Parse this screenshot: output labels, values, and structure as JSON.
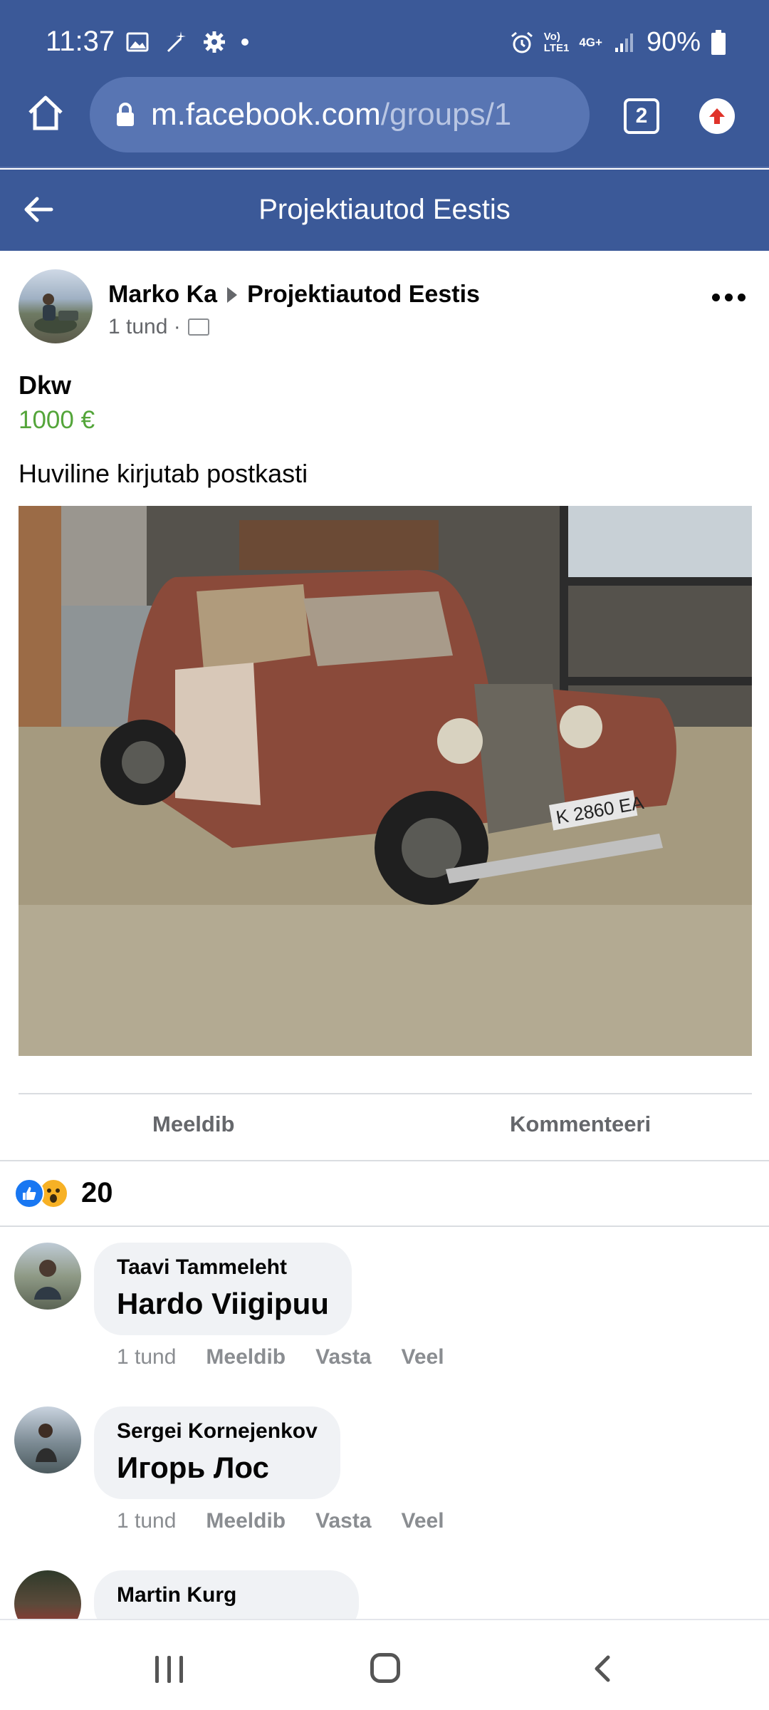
{
  "status_bar": {
    "time": "11:37",
    "battery": "90%",
    "network_top": "Vo)",
    "network_bottom": "LTE1",
    "net_type": "4G+"
  },
  "browser": {
    "url_host": "m.facebook.com",
    "url_path": "/groups/1",
    "tab_count": "2"
  },
  "header": {
    "title": "Projektiautod Eestis"
  },
  "post": {
    "author": "Marko Ka",
    "group": "Projektiautod Eestis",
    "time": "1 tund ·",
    "listing_title": "Dkw",
    "price": "1000 €",
    "text": "Huviline kirjutab postkasti",
    "image_plate_text": "K 2860 EA",
    "actions": {
      "like": "Meeldib",
      "comment": "Kommenteeri"
    },
    "reaction_count": "20"
  },
  "comments": [
    {
      "author": "Taavi Tammeleht",
      "text": "Hardo Viigipuu",
      "time": "1 tund",
      "like": "Meeldib",
      "reply": "Vasta",
      "more": "Veel"
    },
    {
      "author": "Sergei Kornejenkov",
      "text": "Игорь Лос",
      "time": "1 tund",
      "like": "Meeldib",
      "reply": "Vasta",
      "more": "Veel"
    },
    {
      "author": "Martin Kurg"
    }
  ],
  "colors": {
    "facebook_blue": "#3b5998",
    "price_green": "#54a53a",
    "muted_gray": "#65676b"
  }
}
